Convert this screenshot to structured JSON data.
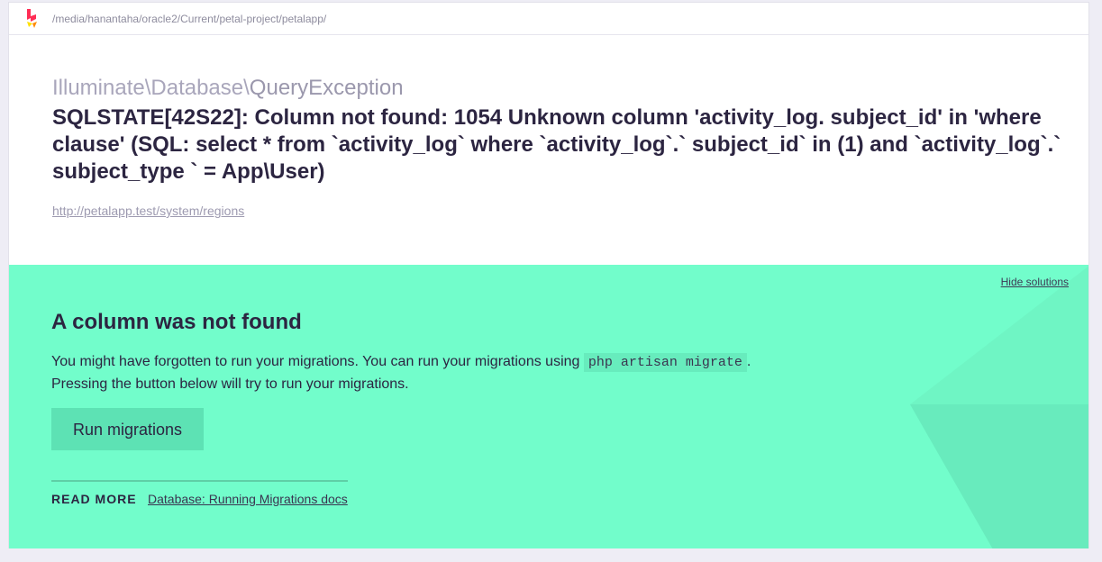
{
  "header": {
    "path": "/media/hanantaha/oracle2/Current/petal-project/petalapp/"
  },
  "exception": {
    "namespace": "Illuminate\\Database\\",
    "class": "QueryException",
    "message": "SQLSTATE[42S22]: Column not found: 1054 Unknown column 'activity_log. subject_id' in 'where clause' (SQL: select * from `activity_log` where `activity_log`.` subject_id` in (1) and `activity_log`.` subject_type ` = App\\User)",
    "url": "http://petalapp.test/system/regions"
  },
  "solution": {
    "hide_label": "Hide solutions",
    "title": "A column was not found",
    "description_before": "You might have forgotten to run your migrations. You can run your migrations using ",
    "code": "php artisan migrate",
    "description_after": ".",
    "description_line2": "Pressing the button below will try to run your migrations.",
    "button_label": "Run migrations",
    "read_more_label": "READ MORE",
    "docs_link": "Database: Running Migrations docs"
  },
  "colors": {
    "solution_bg": "#72fdcb",
    "button_bg": "#5de2b4",
    "text_dark": "#2c2541",
    "logo_red": "#ff2d55",
    "logo_yellow": "#ffe100"
  },
  "icons": {
    "logo": "ignition-logo-icon"
  }
}
